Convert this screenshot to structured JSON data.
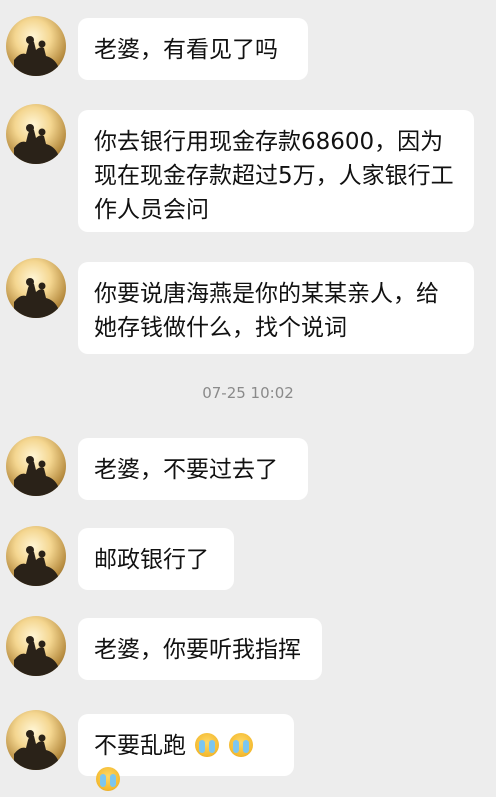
{
  "messages": [
    {
      "text": "老婆，有看见了吗"
    },
    {
      "text": "你去银行用现金存款68600，因为现在现金存款超过5万，人家银行工作人员会问"
    },
    {
      "text": "你要说唐海燕是你的某某亲人，给她存钱做什么，找个说词"
    },
    {
      "text": "老婆，不要过去了"
    },
    {
      "text": "邮政银行了"
    },
    {
      "text": "老婆，你要听我指挥"
    },
    {
      "text": "不要乱跑",
      "emojis": [
        "crying-face-icon",
        "crying-face-icon",
        "crying-face-icon"
      ]
    }
  ],
  "timestamp": "07-25 10:02",
  "colors": {
    "background": "#ededed",
    "bubble": "#ffffff",
    "text": "#111111",
    "timestamp": "#8a8a8a"
  }
}
